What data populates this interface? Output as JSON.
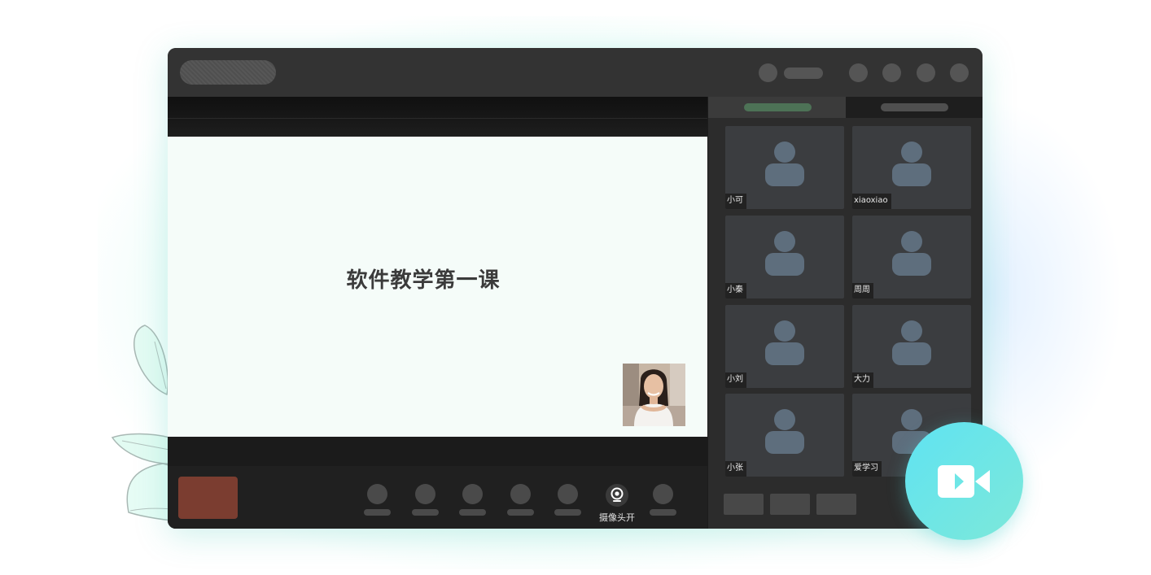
{
  "slide": {
    "title": "软件教学第一课"
  },
  "toolbar": {
    "camera_label": "摄像头开"
  },
  "participants": [
    {
      "name": "小可"
    },
    {
      "name": "xiaoxiao"
    },
    {
      "name": "小秦"
    },
    {
      "name": "周周"
    },
    {
      "name": "小刘"
    },
    {
      "name": "大力"
    },
    {
      "name": "小张"
    },
    {
      "name": "爱学习"
    }
  ],
  "colors": {
    "accent_tab": "#4d7256",
    "record_button": "#7b3d30",
    "fab_gradient_start": "#5fe3f2",
    "fab_gradient_end": "#7de8d9"
  },
  "icons": {
    "camera_toggle": "webcam-icon",
    "participant_avatar": "person-icon",
    "fab": "video-camera-icon"
  }
}
